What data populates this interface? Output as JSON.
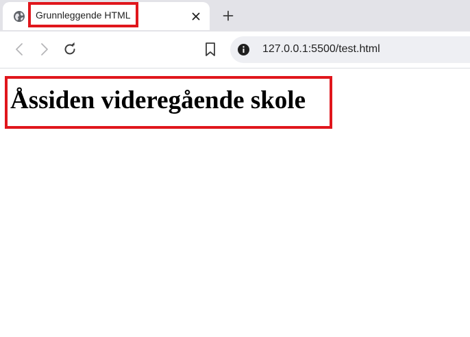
{
  "tab": {
    "title": "Grunnleggende HTML",
    "favicon_icon": "globe-icon",
    "close_icon": "close-icon"
  },
  "tabstrip": {
    "new_tab_icon": "plus-icon"
  },
  "toolbar": {
    "back_icon": "chevron-left-icon",
    "forward_icon": "chevron-right-icon",
    "reload_icon": "reload-icon",
    "bookmark_icon": "bookmark-icon",
    "site_info_icon": "info-icon",
    "url": "127.0.0.1:5500/test.html"
  },
  "page": {
    "heading": "Åssiden videregående skole"
  },
  "colors": {
    "highlight_border": "#e0161c",
    "tabstrip_bg": "#e3e3e8",
    "omnibox_bg": "#eeeff3"
  }
}
